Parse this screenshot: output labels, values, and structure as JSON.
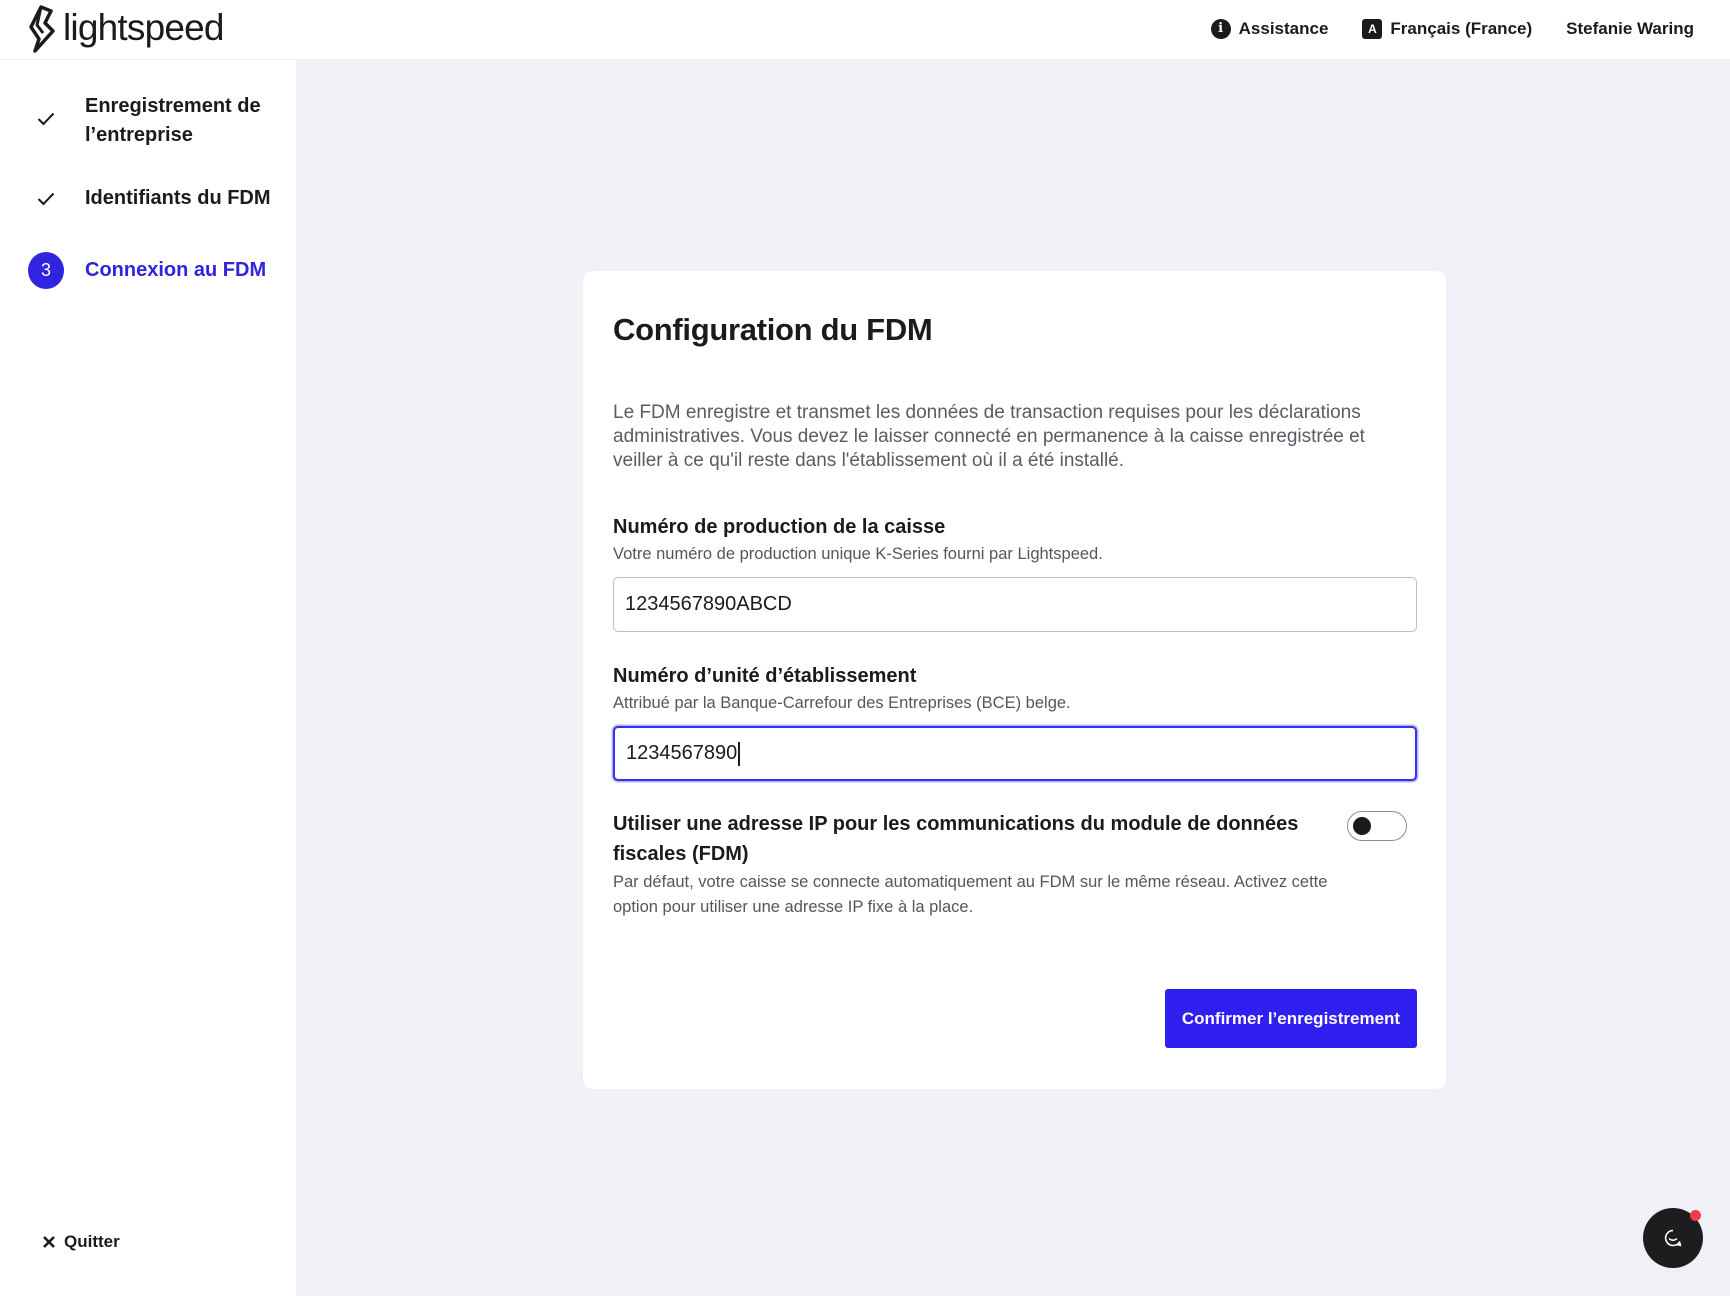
{
  "header": {
    "brand": "lightspeed",
    "nav": {
      "assistance": "Assistance",
      "language": "Français (France)",
      "user": "Stefanie Waring"
    },
    "icons": {
      "assistance": "info-icon",
      "language": "translate-icon"
    }
  },
  "sidebar": {
    "steps": [
      {
        "label": "Enregistrement de l’entreprise",
        "status": "done",
        "icon": "check-icon"
      },
      {
        "label": "Identifiants du FDM",
        "status": "done",
        "icon": "check-icon"
      },
      {
        "number": "3",
        "label": "Connexion au FDM",
        "status": "active"
      }
    ],
    "quit_label": "Quitter"
  },
  "form": {
    "title": "Configuration du FDM",
    "description": "Le FDM enregistre et transmet les données de transaction requises pour les déclarations administratives. Vous devez le laisser connecté en permanence à la caisse enregistrée et veiller à ce qu'il reste dans l'établissement où il a été installé.",
    "production_number": {
      "label": "Numéro de production de la caisse",
      "help": "Votre numéro de production unique K-Series fourni par Lightspeed.",
      "value": "1234567890ABCD"
    },
    "unit_number": {
      "label": "Numéro d’unité d’établissement",
      "help": "Attribué par la Banque-Carrefour des Entreprises (BCE) belge.",
      "value": "1234567890"
    },
    "ip_toggle": {
      "label": "Utiliser une adresse IP pour les communications du module de données fiscales (FDM)",
      "help": "Par défaut, votre caisse se connecte automatiquement au FDM sur le même réseau. Activez cette option pour utiliser une adresse IP fixe à la place.",
      "enabled": false
    },
    "confirm_label": "Confirmer l’enregistrement"
  },
  "colors": {
    "accent": "#2f24e0",
    "background": "#f0f1f6",
    "chat_button": "#1d1d20",
    "notification": "#ef3c48"
  }
}
